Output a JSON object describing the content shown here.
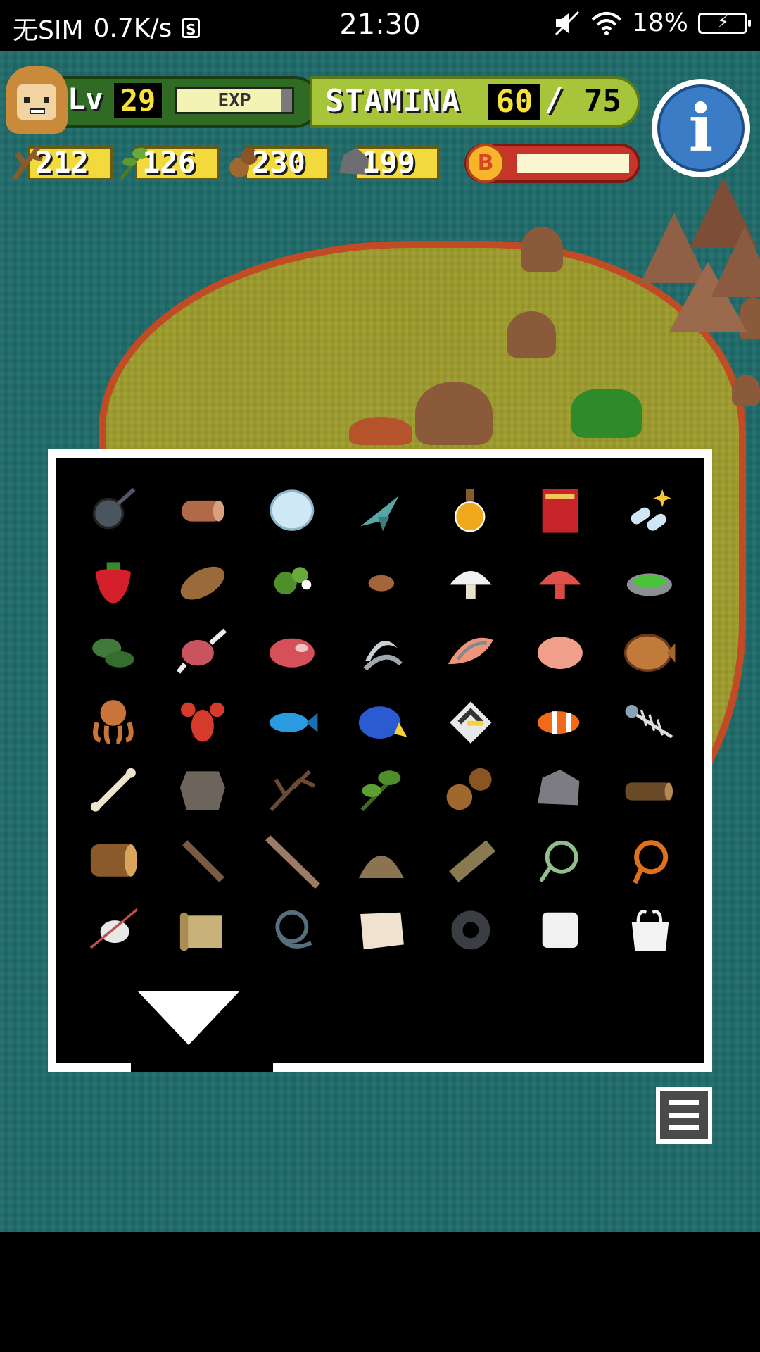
{
  "status_bar": {
    "carrier": "无SIM",
    "speed": "0.7K/s",
    "sim_icon": "S",
    "time": "21:30",
    "battery": "18%",
    "icons": [
      "sim-card-icon",
      "mute-icon",
      "wifi-icon",
      "battery-charging-icon"
    ]
  },
  "hud": {
    "level_label": "Lv",
    "level": "29",
    "exp_label": "EXP",
    "exp_progress": 0.9,
    "stamina_label": "STAMINA",
    "stamina": "60",
    "stamina_sep": "/",
    "stamina_max": "75",
    "boost_label": "B",
    "boost_progress": 1.0,
    "resources": [
      {
        "icon": "branch-icon",
        "value": "212"
      },
      {
        "icon": "leaf-icon",
        "value": "126"
      },
      {
        "icon": "nut-icon",
        "value": "230"
      },
      {
        "icon": "stone-icon",
        "value": "199"
      }
    ],
    "info_glyph": "i"
  },
  "inventory": {
    "items": [
      "frying-pan",
      "log-roll",
      "snowball",
      "fish-fin",
      "potion-bottle",
      "red-book",
      "pills",
      "strawberry",
      "sweet-potato",
      "herb-flowers",
      "bean",
      "white-mushroom",
      "red-mushroom",
      "green-soup",
      "seaweed",
      "meat-on-bone",
      "raw-steak",
      "shrimp-pile",
      "salmon-fillet",
      "ground-meat",
      "flatfish",
      "octopus",
      "lobster",
      "blue-fish",
      "blue-tang",
      "angelfish",
      "clownfish",
      "fish-skeleton",
      "bone",
      "animal-hide",
      "dry-branch",
      "green-leaves",
      "nuts",
      "stone",
      "short-log",
      "log",
      "stick",
      "long-stick",
      "dirt-pile",
      "plank",
      "green-rope",
      "orange-rope",
      "spindle",
      "scroll",
      "wire-coil",
      "cloth",
      "tire",
      "white-cube",
      "plastic-bag"
    ]
  },
  "menu": {
    "icon": "hamburger-menu-icon"
  },
  "colors": {
    "sea": "#1f6b6a",
    "grass": "#9c9b2c",
    "shore": "#c04b24",
    "hud_dark_green": "#2f6b22",
    "hud_light_green": "#a6c53a",
    "number_yellow": "#f7e23c",
    "info_blue": "#3a7cc6",
    "boost_red": "#c7352a"
  }
}
